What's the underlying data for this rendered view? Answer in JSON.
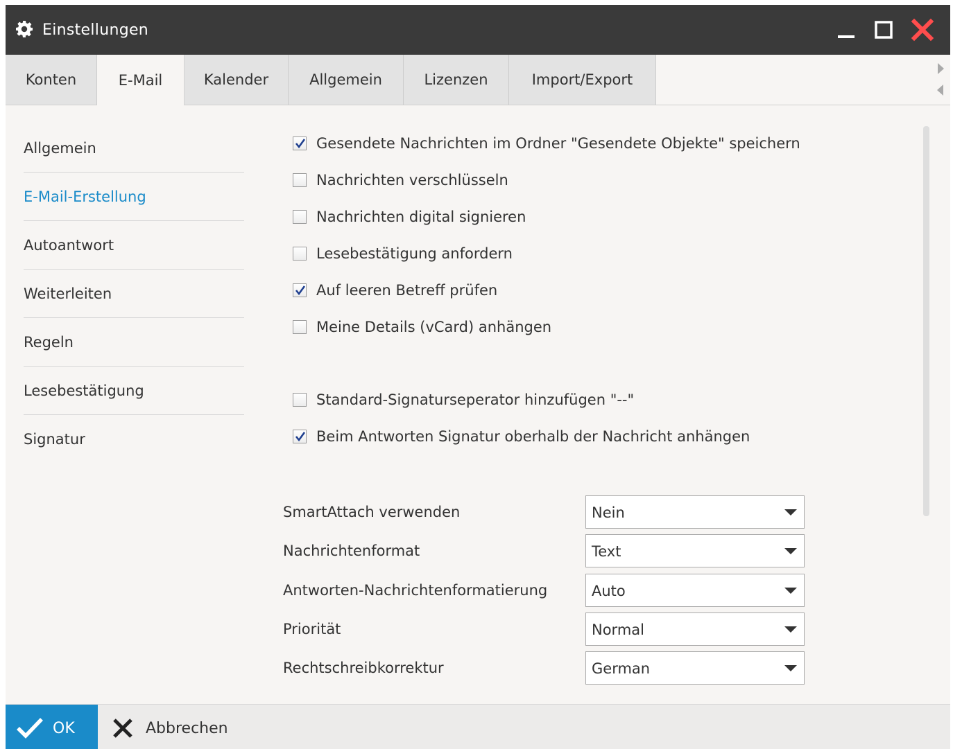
{
  "window": {
    "title": "Einstellungen",
    "icons": {
      "app": "gear-icon",
      "minimize": "minimize-icon",
      "maximize": "maximize-icon",
      "close": "close-icon"
    },
    "close_color": "#ff4d4d"
  },
  "tabs": [
    {
      "label": "Konten",
      "active": false
    },
    {
      "label": "E-Mail",
      "active": true
    },
    {
      "label": "Kalender",
      "active": false
    },
    {
      "label": "Allgemein",
      "active": false
    },
    {
      "label": "Lizenzen",
      "active": false
    },
    {
      "label": "Import/Export",
      "active": false
    }
  ],
  "sidebar": {
    "items": [
      {
        "label": "Allgemein",
        "active": false
      },
      {
        "label": "E-Mail-Erstellung",
        "active": true
      },
      {
        "label": "Autoantwort",
        "active": false
      },
      {
        "label": "Weiterleiten",
        "active": false
      },
      {
        "label": "Regeln",
        "active": false
      },
      {
        "label": "Lesebestätigung",
        "active": false
      },
      {
        "label": "Signatur",
        "active": false
      }
    ],
    "active_color": "#1a8bc9"
  },
  "options": [
    {
      "label": "Gesendete Nachrichten im Ordner \"Gesendete Objekte\" speichern",
      "checked": true
    },
    {
      "label": "Nachrichten verschlüsseln",
      "checked": false
    },
    {
      "label": "Nachrichten digital signieren",
      "checked": false
    },
    {
      "label": "Lesebestätigung anfordern",
      "checked": false
    },
    {
      "label": "Auf leeren Betreff prüfen",
      "checked": true
    },
    {
      "label": "Meine Details (vCard) anhängen",
      "checked": false
    },
    {
      "label": "Standard-Signaturseperator hinzufügen \"--\"",
      "checked": false
    },
    {
      "label": "Beim Antworten Signatur oberhalb der Nachricht anhängen",
      "checked": true
    }
  ],
  "settings": [
    {
      "label": "SmartAttach verwenden",
      "value": "Nein"
    },
    {
      "label": "Nachrichtenformat",
      "value": "Text"
    },
    {
      "label": "Antworten-Nachrichtenformatierung",
      "value": "Auto"
    },
    {
      "label": "Priorität",
      "value": "Normal"
    },
    {
      "label": "Rechtschreibkorrektur",
      "value": "German"
    }
  ],
  "footer": {
    "ok_label": "OK",
    "cancel_label": "Abbrechen",
    "ok_color": "#1a8bc9"
  }
}
